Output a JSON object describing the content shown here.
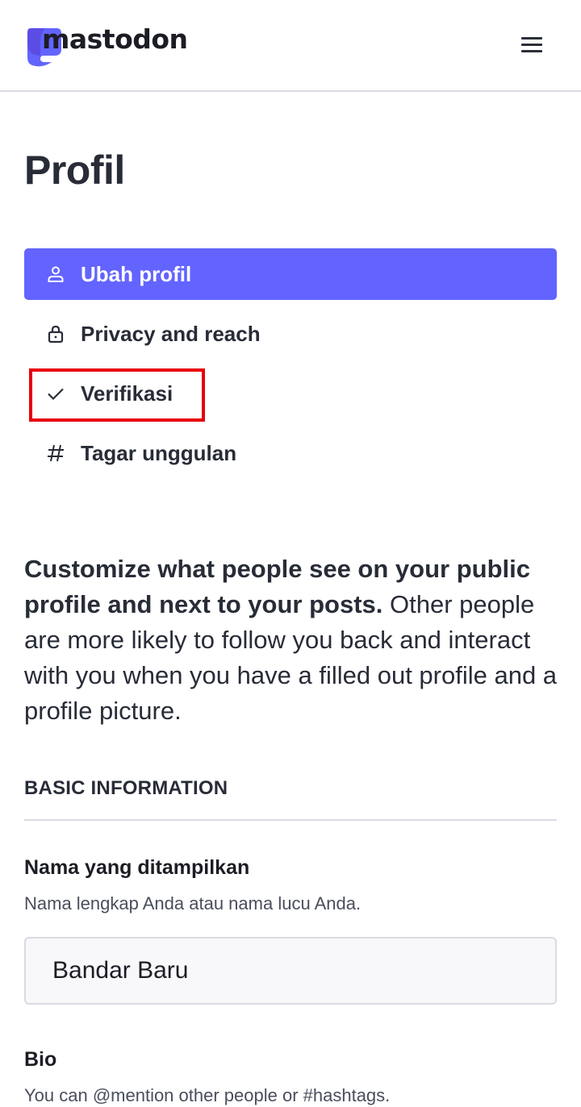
{
  "header": {
    "brand": "mastodon",
    "logo_icon": "mastodon-logo-icon",
    "menu_icon": "hamburger-menu-icon",
    "brand_color": "#6364ff"
  },
  "page": {
    "title": "Profil"
  },
  "nav": {
    "items": [
      {
        "label": "Ubah profil",
        "icon": "person-icon",
        "active": true
      },
      {
        "label": "Privacy and reach",
        "icon": "lock-icon",
        "active": false
      },
      {
        "label": "Verifikasi",
        "icon": "check-icon",
        "active": false,
        "highlighted": true
      },
      {
        "label": "Tagar unggulan",
        "icon": "hashtag-icon",
        "active": false
      }
    ],
    "active_color": "#6364ff",
    "highlight_color": "#e8000b"
  },
  "lead": {
    "strong": "Customize what people see on your public profile and next to your posts.",
    "text": " Other people are more likely to follow you back and interact with you when you have a filled out profile and a profile picture."
  },
  "basic_information": {
    "heading": "BASIC INFORMATION",
    "display_name": {
      "label": "Nama yang ditampilkan",
      "hint": "Nama lengkap Anda atau nama lucu Anda.",
      "value": "Bandar Baru"
    },
    "bio": {
      "label": "Bio",
      "hint": "You can @mention other people or #hashtags."
    }
  }
}
